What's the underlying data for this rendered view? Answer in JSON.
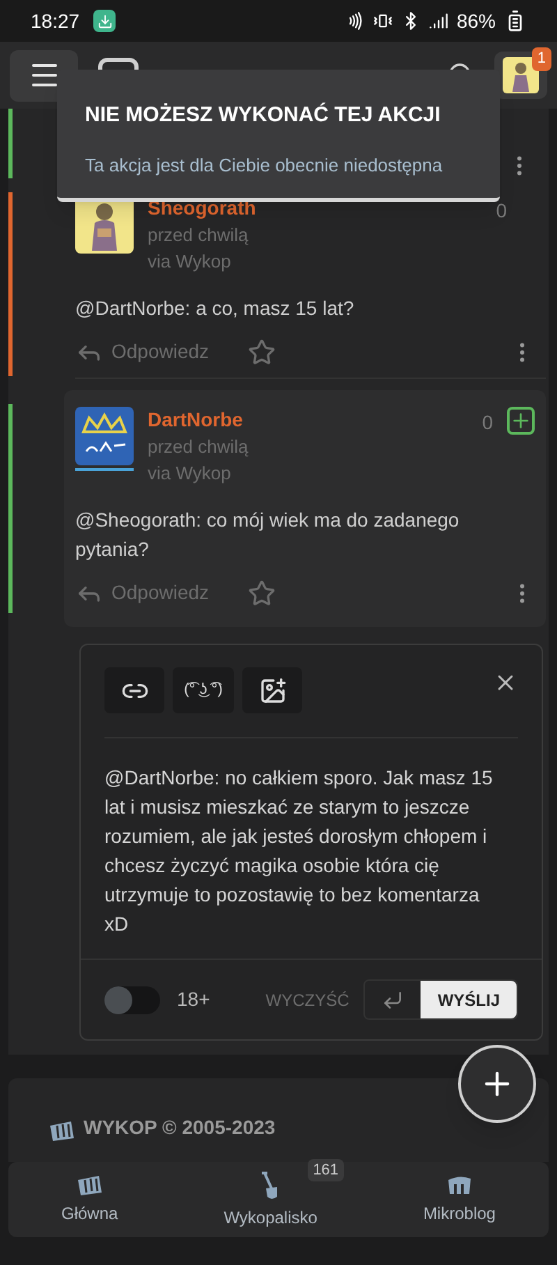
{
  "status_bar": {
    "time": "18:27",
    "battery": "86%"
  },
  "header": {
    "notification_count": "1"
  },
  "toast": {
    "title": "NIE MOŻESZ WYKONAĆ TEJ AKCJI",
    "message": "Ta akcja jest dla Ciebie obecnie niedostępna"
  },
  "comments": [
    {
      "kind": "partial",
      "color": "#5cb85c"
    },
    {
      "kind": "full",
      "color": "#e0662f",
      "author": "Sheogorath",
      "time": "przed chwilą",
      "via": "via Wykop",
      "votes": "0",
      "text": "@DartNorbe: a co, masz 15 lat?",
      "reply": "Odpowiedz",
      "highlighted": false,
      "can_vote": false
    },
    {
      "kind": "full",
      "color": "#5cb85c",
      "author": "DartNorbe",
      "time": "przed chwilą",
      "via": "via Wykop",
      "votes": "0",
      "text": "@Sheogorath: co mój wiek ma do zadanego pytania?",
      "reply": "Odpowiedz",
      "highlighted": true,
      "can_vote": true
    }
  ],
  "editor": {
    "emoticon": "(͡° ͜ʖ ͡°)",
    "value": "@DartNorbe: no całkiem sporo. Jak masz 15 lat i musisz mieszkać ze starym to jeszcze rozumiem, ale jak jesteś dorosłym chłopem i chcesz życzyć magika osobie która cię utrzymuje to pozostawię to bez komentarza xD",
    "adult": {
      "label": "18+",
      "on": false
    },
    "clear": "WYCZYŚĆ",
    "send": "WYŚLIJ"
  },
  "footer": {
    "copyright": "WYKOP © 2005-2023"
  },
  "bottom_nav": [
    {
      "label": "Główna"
    },
    {
      "label": "Wykopalisko",
      "badge": "161"
    },
    {
      "label": "Mikroblog"
    }
  ]
}
